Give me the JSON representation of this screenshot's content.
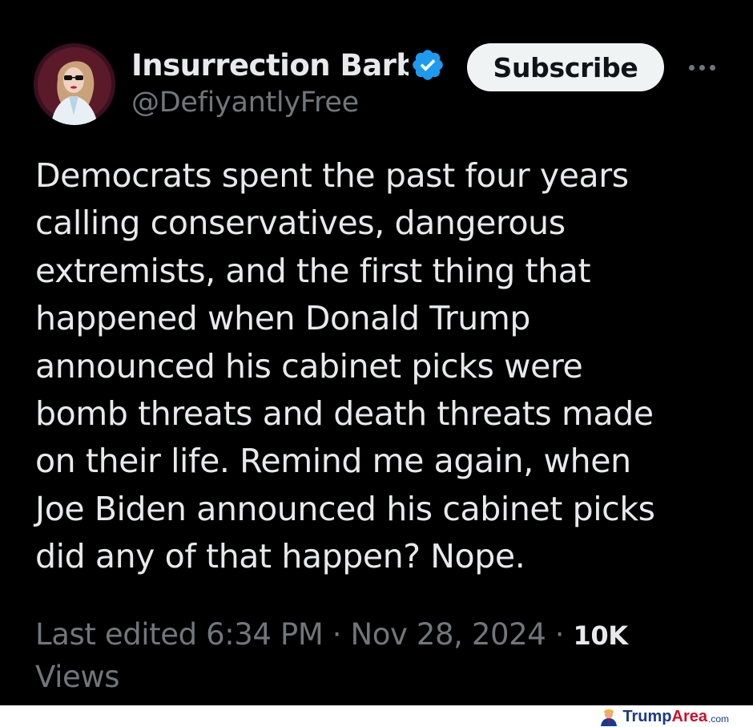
{
  "author": {
    "display_name": "Insurrection Barbie",
    "handle": "@DefiyantlyFree",
    "verified_icon": "verified-badge-icon",
    "verified_color": "#1d9bf0"
  },
  "actions": {
    "subscribe_label": "Subscribe",
    "more_icon": "more-options-icon"
  },
  "tweet": {
    "lines": [
      "Democrats spent the past four years",
      "calling conservatives, dangerous",
      "extremists, and the first thing that",
      "happened when Donald Trump",
      "announced his cabinet picks were",
      "bomb threats and death threats made",
      "on their life. Remind me again, when",
      "Joe Biden announced his cabinet picks",
      "did any of that happen? Nope."
    ]
  },
  "meta": {
    "edited_label": "Last edited 6:34 PM",
    "separator": " · ",
    "date": "Nov 28, 2024",
    "views_count": "10K",
    "views_label": "Views"
  },
  "watermark": {
    "part1": "Trump",
    "part2": "Area",
    "tld": ".com",
    "icon": "trump-figure-icon"
  },
  "colors": {
    "background": "#000000",
    "text": "#e7e9ea",
    "secondary_text": "#71767b",
    "subscribe_bg": "#eff3f4"
  }
}
